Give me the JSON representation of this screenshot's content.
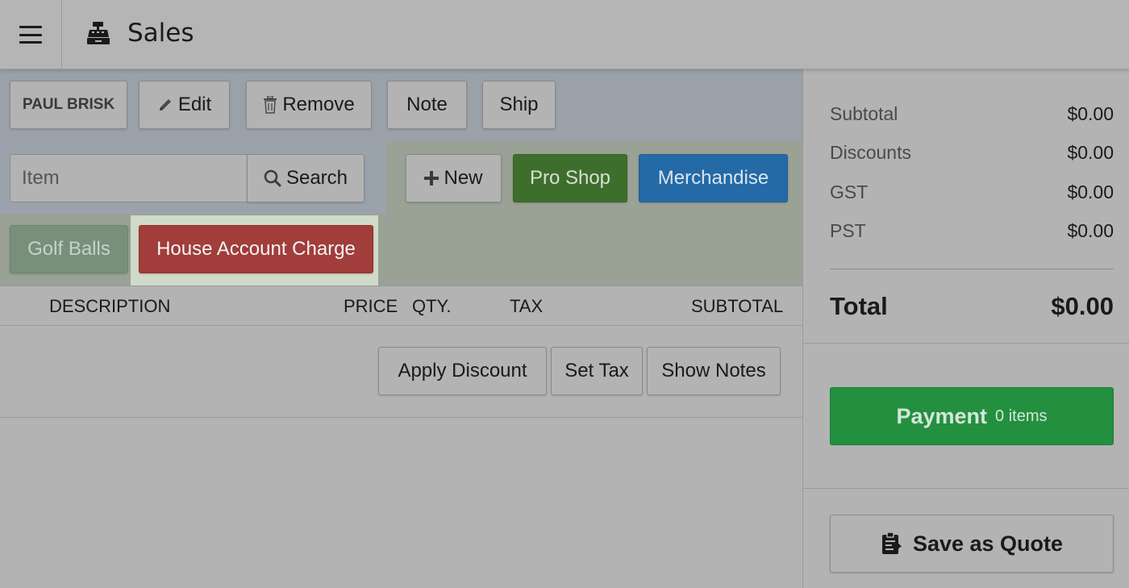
{
  "header": {
    "title": "Sales",
    "menu_icon": "hamburger-icon",
    "title_icon": "cash-register-icon"
  },
  "customer_bar": {
    "customer_label": "PAUL BRISK",
    "edit_label": "Edit",
    "remove_label": "Remove",
    "note_label": "Note",
    "ship_label": "Ship"
  },
  "search": {
    "placeholder": "Item",
    "search_label": "Search",
    "new_label": "New"
  },
  "categories": {
    "pro_shop": "Pro Shop",
    "merchandise": "Merchandise",
    "golf_balls": "Golf Balls",
    "house_account_charge": "House Account Charge"
  },
  "table": {
    "columns": [
      "DESCRIPTION",
      "PRICE",
      "QTY.",
      "TAX",
      "SUBTOTAL"
    ]
  },
  "actions": {
    "apply_discount": "Apply Discount",
    "set_tax": "Set Tax",
    "show_notes": "Show Notes"
  },
  "summary": {
    "rows": [
      {
        "label": "Subtotal",
        "value": "$0.00"
      },
      {
        "label": "Discounts",
        "value": "$0.00"
      },
      {
        "label": "GST",
        "value": "$0.00"
      },
      {
        "label": "PST",
        "value": "$0.00"
      }
    ],
    "total_label": "Total",
    "total_value": "$0.00"
  },
  "payment": {
    "label": "Payment",
    "items": "0 items"
  },
  "quote": {
    "label": "Save as Quote"
  },
  "colors": {
    "pro_shop": "#3e6e2c",
    "merchandise": "#236aa6",
    "house_account": "#a13d3a",
    "payment": "#23903f"
  }
}
